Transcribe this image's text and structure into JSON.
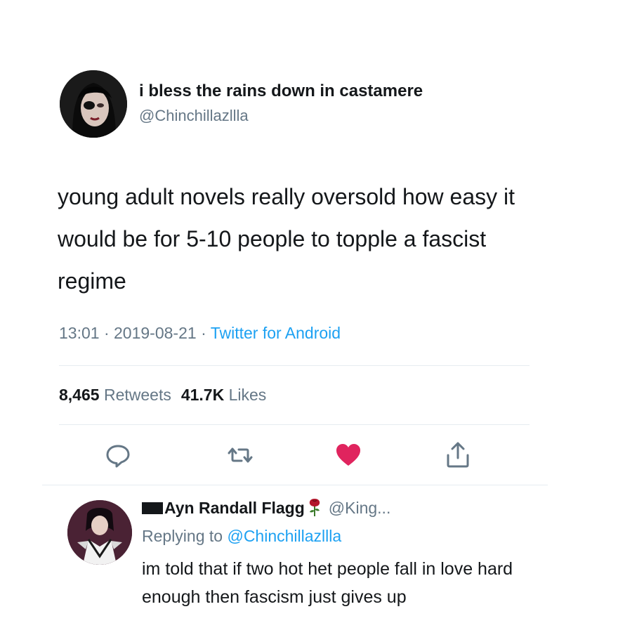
{
  "tweet": {
    "author": {
      "name": "i bless the rains down in castamere",
      "handle": "@Chinchillazllla"
    },
    "text": "young adult novels really oversold how easy it would be for 5-10 people to topple a fascist regime",
    "time": "13:01",
    "date": "2019-08-21",
    "source": "Twitter for Android",
    "retweets_count": "8,465",
    "retweets_label": "Retweets",
    "likes_count": "41.7K",
    "likes_label": "Likes"
  },
  "actions": {
    "reply_icon": "comment-bubble-icon",
    "retweet_icon": "retweet-icon",
    "like_icon": "heart-icon",
    "share_icon": "share-icon",
    "like_color": "#e0245e"
  },
  "reply": {
    "name": "Ayn Randall Flagg",
    "handle": "@King...",
    "replying_prefix": "Replying to",
    "replying_to": "@Chinchillazllla",
    "text": "im told that if two hot het people fall in love hard enough then fascism just gives up"
  },
  "colors": {
    "text": "#14171a",
    "muted": "#657786",
    "link": "#1da1f2",
    "divider": "#e6ecf0"
  }
}
